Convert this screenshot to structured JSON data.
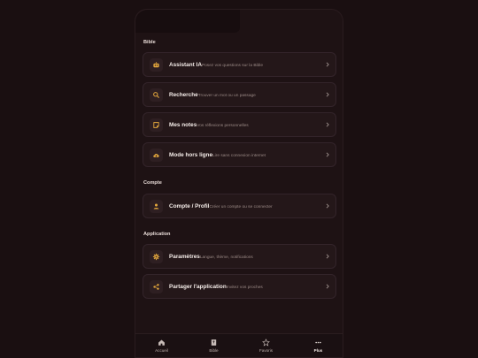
{
  "sections": [
    {
      "title": "Bible",
      "items": [
        {
          "title": "Assistant IA",
          "subtitle": "Posez vos questions sur la Bible",
          "icon": "robot-icon"
        },
        {
          "title": "Recherche",
          "subtitle": "Trouver un mot ou un passage",
          "icon": "search-icon"
        },
        {
          "title": "Mes notes",
          "subtitle": "Vos réflexions personnelles",
          "icon": "note-icon"
        },
        {
          "title": "Mode hors ligne",
          "subtitle": "Lire sans connexion internet",
          "icon": "cloud-download-icon"
        }
      ]
    },
    {
      "title": "Compte",
      "items": [
        {
          "title": "Compte / Profil",
          "subtitle": "Créer un compte ou se connecter",
          "icon": "person-icon"
        }
      ]
    },
    {
      "title": "Application",
      "items": [
        {
          "title": "Paramètres",
          "subtitle": "Langue, thème, notifications",
          "icon": "gear-icon"
        },
        {
          "title": "Partager l'application",
          "subtitle": "Invitez vos proches",
          "icon": "share-icon"
        }
      ]
    }
  ],
  "nav": [
    {
      "label": "Accueil",
      "icon": "home-icon"
    },
    {
      "label": "Bible",
      "icon": "book-icon"
    },
    {
      "label": "Favoris",
      "icon": "star-icon"
    },
    {
      "label": "Plus",
      "icon": "more-icon",
      "active": true
    }
  ],
  "colors": {
    "accent": "#e2a63c",
    "background": "#1a0f11",
    "card": "#241719"
  }
}
